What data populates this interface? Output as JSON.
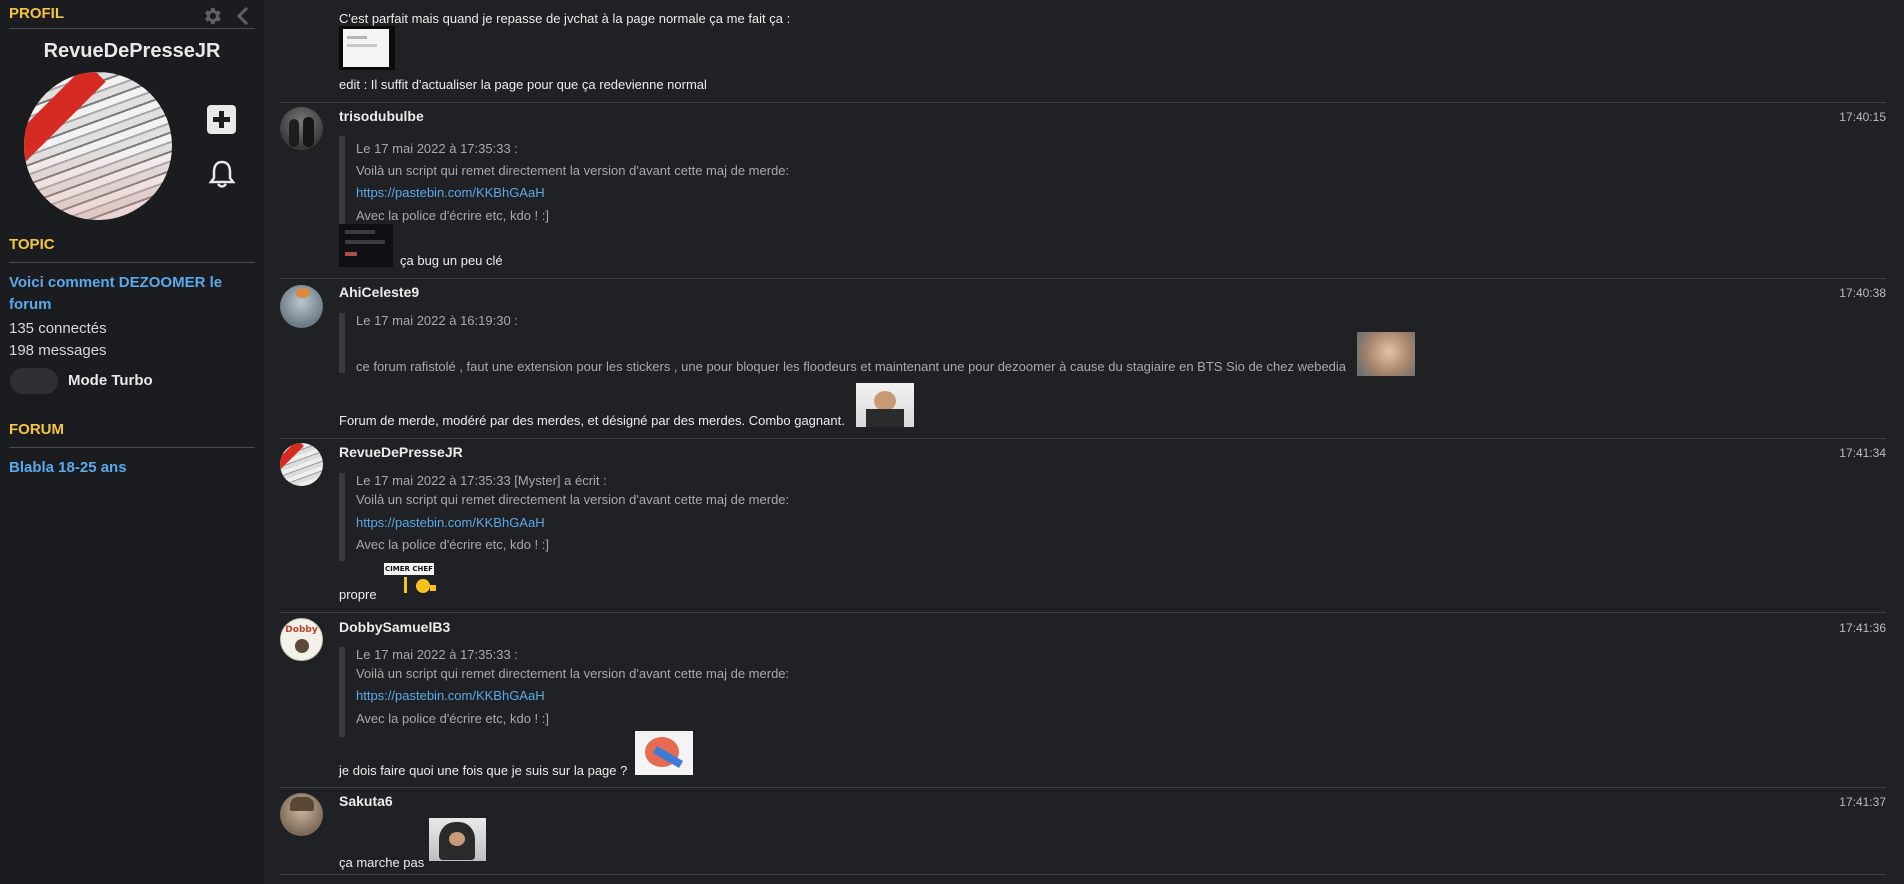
{
  "sidebar": {
    "profil_heading": "PROFIL",
    "username": "RevueDePresseJR",
    "topic_heading": "TOPIC",
    "topic_title": "Voici comment DEZOOMER le forum",
    "connected": "135 connectés",
    "messages_count": "198 messages",
    "turbo_label": "Mode Turbo",
    "turbo_on": false,
    "forum_heading": "FORUM",
    "forum_name": "Blabla 18-25 ans",
    "icons": {
      "settings": "gear-icon",
      "collapse": "chevron-left-icon",
      "add": "plus-square-icon",
      "notify": "bell-icon"
    }
  },
  "colors": {
    "accent_heading": "#f5c542",
    "link": "#5aa9ea",
    "background": "#202124",
    "sidebar": "#1b1c1f"
  },
  "messages": [
    {
      "partial": true,
      "text1": "C'est parfait mais quand je repasse de jvchat à la page normale ça me fait ça :",
      "text2": "edit : Il suffit d'actualiser la page pour que ça redevienne normal"
    },
    {
      "author": "trisodubulbe",
      "time": "17:40:15",
      "quote": [
        "Le 17 mai 2022 à 17:35:33 :",
        "Voilà un script qui remet directement la version d'avant cette maj de merde:",
        "https://pastebin.com/KKBhGAaH",
        "Avec la police d'écrire etc, kdo ! :]"
      ],
      "text": "ça bug un peu clé"
    },
    {
      "author": "AhiCeleste9",
      "time": "17:40:38",
      "quote": [
        "Le 17 mai 2022 à 16:19:30 :",
        "ce forum rafistolé , faut une extension pour les stickers , une pour bloquer les floodeurs et maintenant une pour dezoomer à cause du stagiaire en BTS Sio de chez webedia"
      ],
      "text": "Forum de merde, modéré par des merdes, et désigné par des merdes. Combo gagnant."
    },
    {
      "author": "RevueDePresseJR",
      "time": "17:41:34",
      "quote": [
        "Le 17 mai 2022 à 17:35:33 [Myster] a écrit :",
        "Voilà un script qui remet directement la version d'avant cette maj de merde:",
        "https://pastebin.com/KKBhGAaH",
        "Avec la police d'écrire etc, kdo ! :]"
      ],
      "text": "propre",
      "sticker_caption": "CIMER CHEF"
    },
    {
      "author": "DobbySamuelB3",
      "time": "17:41:36",
      "quote": [
        "Le 17 mai 2022 à 17:35:33 :",
        "Voilà un script qui remet directement la version d'avant cette maj de merde:",
        "https://pastebin.com/KKBhGAaH",
        "Avec la police d'écrire etc, kdo ! :]"
      ],
      "text": "je dois faire quoi une fois que je suis sur la page ?",
      "avatar_text": "Dobby"
    },
    {
      "author": "Sakuta6",
      "time": "17:41:37",
      "text": "ça marche pas"
    }
  ]
}
